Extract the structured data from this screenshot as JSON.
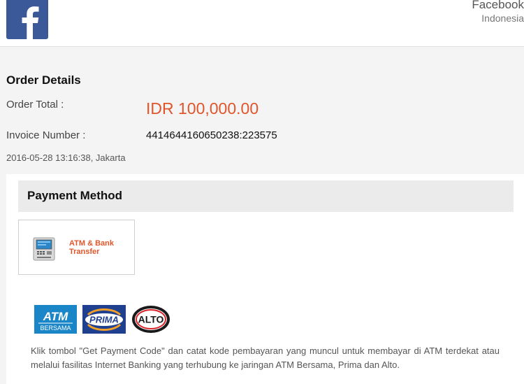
{
  "header": {
    "logo": "facebook-logo",
    "merchant_name": "Facebook",
    "merchant_country": "Indonesia"
  },
  "order": {
    "title": "Order Details",
    "total_label": "Order Total :",
    "total_value": "IDR 100,000.00",
    "invoice_label": "Invoice Number :",
    "invoice_value": "4414644160650238:223575",
    "timestamp": "2016-05-28 13:16:38, Jakarta"
  },
  "payment": {
    "title": "Payment Method",
    "options": [
      {
        "label": "ATM & Bank Transfer",
        "icon": "atm-machine-icon"
      }
    ],
    "network_logos": [
      {
        "name": "ATM BERSAMA",
        "top": "ATM",
        "bottom": "BERSAMA"
      },
      {
        "name": "PRIMA",
        "text": "PRIMA"
      },
      {
        "name": "ALTO",
        "text": "ALTO"
      }
    ],
    "instructions": "Klik tombol \"Get Payment Code\" dan catat kode pembayaran yang muncul untuk membayar di ATM terdekat atau melalui fasilitas Internet Banking yang terhubung ke jaringan ATM Bersama, Prima dan Alto."
  },
  "colors": {
    "facebook_blue": "#3b5998",
    "accent_orange": "#e0552a",
    "panel_header": "#ebebeb"
  }
}
